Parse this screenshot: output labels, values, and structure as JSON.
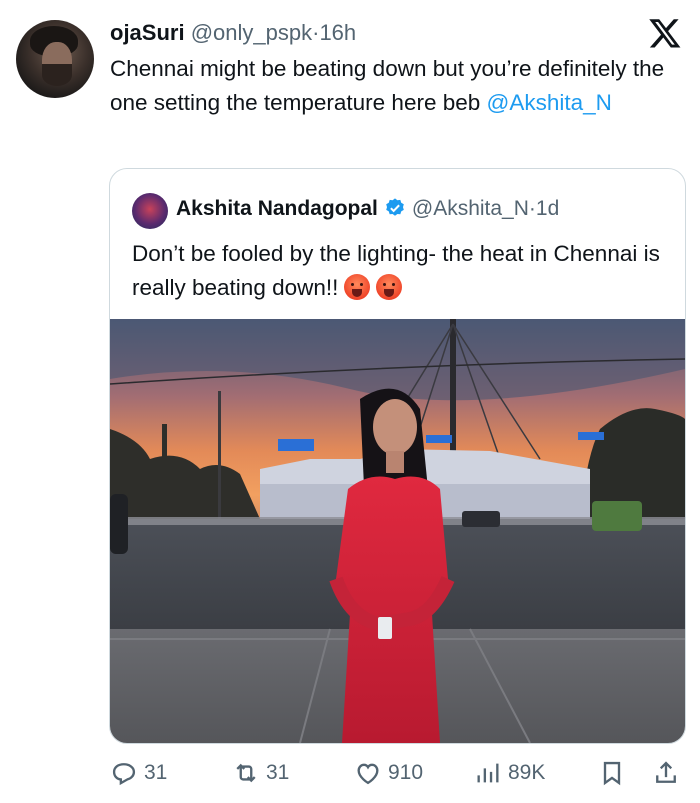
{
  "tweet": {
    "author_name": "ojaSuri",
    "handle": "@only_pspk",
    "separator": "·",
    "time": "16h",
    "text_main": "Chennai might be beating down but you’re definitely the one setting the temperature here beb ",
    "text_mention": "@Akshita_N"
  },
  "quote": {
    "author_name": "Akshita Nandagopal",
    "handle": "@Akshita_N",
    "separator": "·",
    "time": "1d",
    "text": "Don’t be fooled by the lighting- the heat in Chennai is really beating down!!",
    "emojis": [
      "hot-face-emoji",
      "hot-face-emoji"
    ]
  },
  "actions": {
    "replies": "31",
    "reposts": "31",
    "likes": "910",
    "views": "89K"
  },
  "colors": {
    "text": "#0f1419",
    "secondary": "#536471",
    "link": "#1d9bf0",
    "border": "#cfd9de",
    "dress": "#d4263a"
  },
  "icons": [
    "x-logo-icon",
    "verified-badge-icon",
    "reply-icon",
    "repost-icon",
    "like-icon",
    "views-icon",
    "bookmark-icon",
    "share-icon"
  ]
}
